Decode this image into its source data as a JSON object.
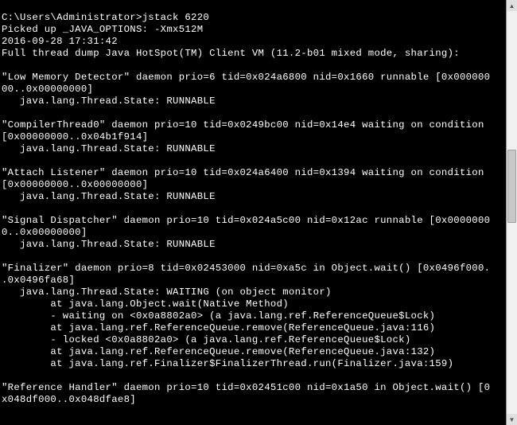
{
  "prompt_line": "C:\\Users\\Administrator>jstack 6220",
  "lines": [
    "Picked up _JAVA_OPTIONS: -Xmx512M",
    "2016-09-28 17:31:42",
    "Full thread dump Java HotSpot(TM) Client VM (11.2-b01 mixed mode, sharing):",
    "",
    "\"Low Memory Detector\" daemon prio=6 tid=0x024a6800 nid=0x1660 runnable [0x000000",
    "00..0x00000000]",
    "   java.lang.Thread.State: RUNNABLE",
    "",
    "\"CompilerThread0\" daemon prio=10 tid=0x0249bc00 nid=0x14e4 waiting on condition",
    "[0x00000000..0x04b1f914]",
    "   java.lang.Thread.State: RUNNABLE",
    "",
    "\"Attach Listener\" daemon prio=10 tid=0x024a6400 nid=0x1394 waiting on condition",
    "[0x00000000..0x00000000]",
    "   java.lang.Thread.State: RUNNABLE",
    "",
    "\"Signal Dispatcher\" daemon prio=10 tid=0x024a5c00 nid=0x12ac runnable [0x0000000",
    "0..0x00000000]",
    "   java.lang.Thread.State: RUNNABLE",
    "",
    "\"Finalizer\" daemon prio=8 tid=0x02453000 nid=0xa5c in Object.wait() [0x0496f000.",
    ".0x0496fa68]",
    "   java.lang.Thread.State: WAITING (on object monitor)",
    "        at java.lang.Object.wait(Native Method)",
    "        - waiting on <0x0a8802a0> (a java.lang.ref.ReferenceQueue$Lock)",
    "        at java.lang.ref.ReferenceQueue.remove(ReferenceQueue.java:116)",
    "        - locked <0x0a8802a0> (a java.lang.ref.ReferenceQueue$Lock)",
    "        at java.lang.ref.ReferenceQueue.remove(ReferenceQueue.java:132)",
    "        at java.lang.ref.Finalizer$FinalizerThread.run(Finalizer.java:159)",
    "",
    "\"Reference Handler\" daemon prio=10 tid=0x02451c00 nid=0x1a50 in Object.wait() [0",
    "x048df000..0x048dfae8]"
  ]
}
